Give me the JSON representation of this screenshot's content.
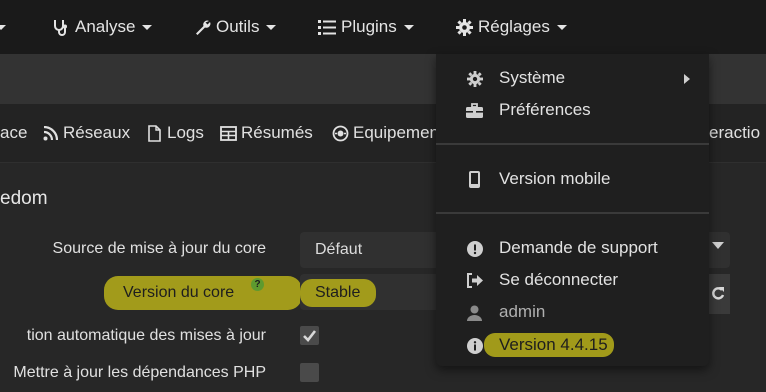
{
  "navbar": {
    "analyse": "Analyse",
    "outils": "Outils",
    "plugins": "Plugins",
    "reglages": "Réglages"
  },
  "tabs": {
    "interface": "ace",
    "reseaux": "Réseaux",
    "logs": "Logs",
    "resumes": "Résumés",
    "equipements": "Equipemen",
    "interaction": "eractio"
  },
  "content": {
    "section_title": "edom",
    "source_label": "Source de mise à jour du core",
    "source_value": "Défaut",
    "version_label": "Version du core",
    "version_value": "Stable",
    "auto_check_label": "tion automatique des mises à jour",
    "php_label": "Mettre à jour les dépendances PHP"
  },
  "menu": {
    "systeme": "Système",
    "preferences": "Préférences",
    "version_mobile": "Version mobile",
    "support": "Demande de support",
    "logout": "Se déconnecter",
    "user": "admin",
    "version": "Version 4.4.15"
  },
  "colors": {
    "highlight": "#a9a11a",
    "navbar_bg": "#1a1a1a",
    "menu_bg": "#1f1f1f"
  }
}
